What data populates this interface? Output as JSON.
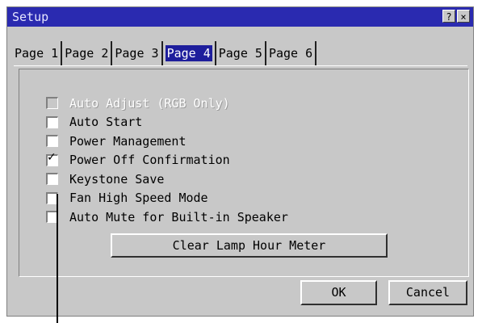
{
  "window": {
    "title": "Setup",
    "help_label": "?",
    "close_label": "×"
  },
  "tabs": [
    {
      "label": "Page 1",
      "active": false
    },
    {
      "label": "Page 2",
      "active": false
    },
    {
      "label": "Page 3",
      "active": false
    },
    {
      "label": "Page 4",
      "active": true
    },
    {
      "label": "Page 5",
      "active": false
    },
    {
      "label": "Page 6",
      "active": false
    }
  ],
  "options": [
    {
      "label": "Auto Adjust (RGB Only)",
      "checked": false,
      "enabled": false
    },
    {
      "label": "Auto Start",
      "checked": false,
      "enabled": true
    },
    {
      "label": "Power Management",
      "checked": false,
      "enabled": true
    },
    {
      "label": "Power Off Confirmation",
      "checked": true,
      "enabled": true
    },
    {
      "label": "Keystone Save",
      "checked": false,
      "enabled": true
    },
    {
      "label": "Fan High Speed Mode",
      "checked": false,
      "enabled": true
    },
    {
      "label": "Auto Mute for Built-in Speaker",
      "checked": false,
      "enabled": true
    }
  ],
  "check_mark": "✓",
  "buttons": {
    "clear_lamp": "Clear Lamp Hour Meter",
    "ok": "OK",
    "cancel": "Cancel"
  }
}
